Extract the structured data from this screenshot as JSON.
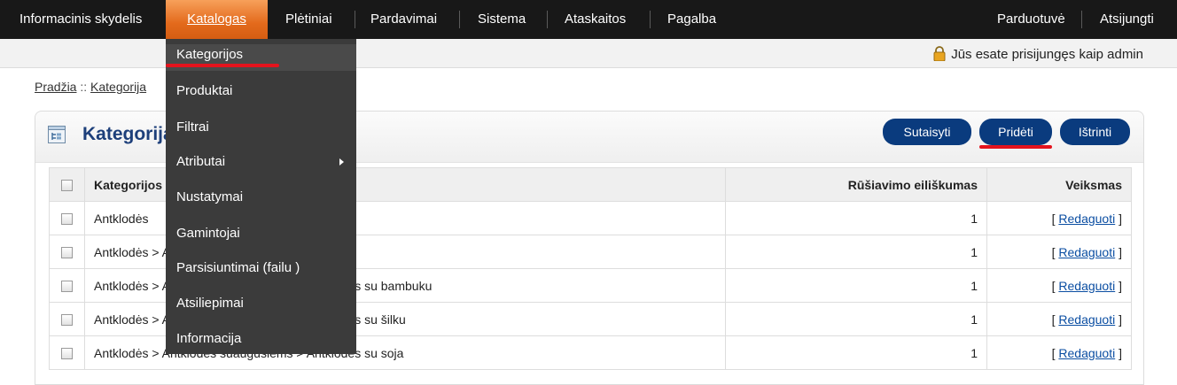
{
  "topnav": {
    "items": [
      "Informacinis skydelis",
      "Katalogas",
      "Plėtiniai",
      "Pardavimai",
      "Sistema",
      "Ataskaitos",
      "Pagalba"
    ],
    "right": [
      "Parduotuvė",
      "Atsijungti"
    ]
  },
  "login_text": "Jūs esate prisijungęs kaip admin",
  "breadcrumb": {
    "home": "Pradžia",
    "sep": " :: ",
    "current": "Kategorija"
  },
  "panel": {
    "title": "Kategorija",
    "buttons": {
      "repair": "Sutaisyti",
      "add": "Pridėti",
      "delete": "Ištrinti"
    }
  },
  "table": {
    "headers": {
      "name": "Kategorijos pavadinimas",
      "sort": "Rūšiavimo eiliškumas",
      "action": "Veiksmas"
    },
    "rows": [
      {
        "name": "Antklodės",
        "sort": "1",
        "action": "Redaguoti"
      },
      {
        "name": "Antklodės > Antklodės suaugusiems",
        "sort": "1",
        "action": "Redaguoti"
      },
      {
        "name": "Antklodės > Antklodės suaugusiems > Antklodės su bambuku",
        "sort": "1",
        "action": "Redaguoti"
      },
      {
        "name": "Antklodės > Antklodės suaugusiems > Antklodės su šilku",
        "sort": "1",
        "action": "Redaguoti"
      },
      {
        "name": "Antklodės > Antklodės suaugusiems > Antklodės su soja",
        "sort": "1",
        "action": "Redaguoti"
      }
    ],
    "edit_open": "[ ",
    "edit_close": " ]"
  },
  "dropdown": {
    "items": [
      "Kategorijos",
      "Produktai",
      "Filtrai",
      "Atributai",
      "Nustatymai",
      "Gamintojai",
      "Parsisiuntimai (failu )",
      "Atsiliepimai",
      "Informacija"
    ]
  },
  "colors": {
    "accent_orange": "#e36a1c",
    "brand_blue": "#0a3b7e",
    "annotation_red": "#e4131d"
  }
}
